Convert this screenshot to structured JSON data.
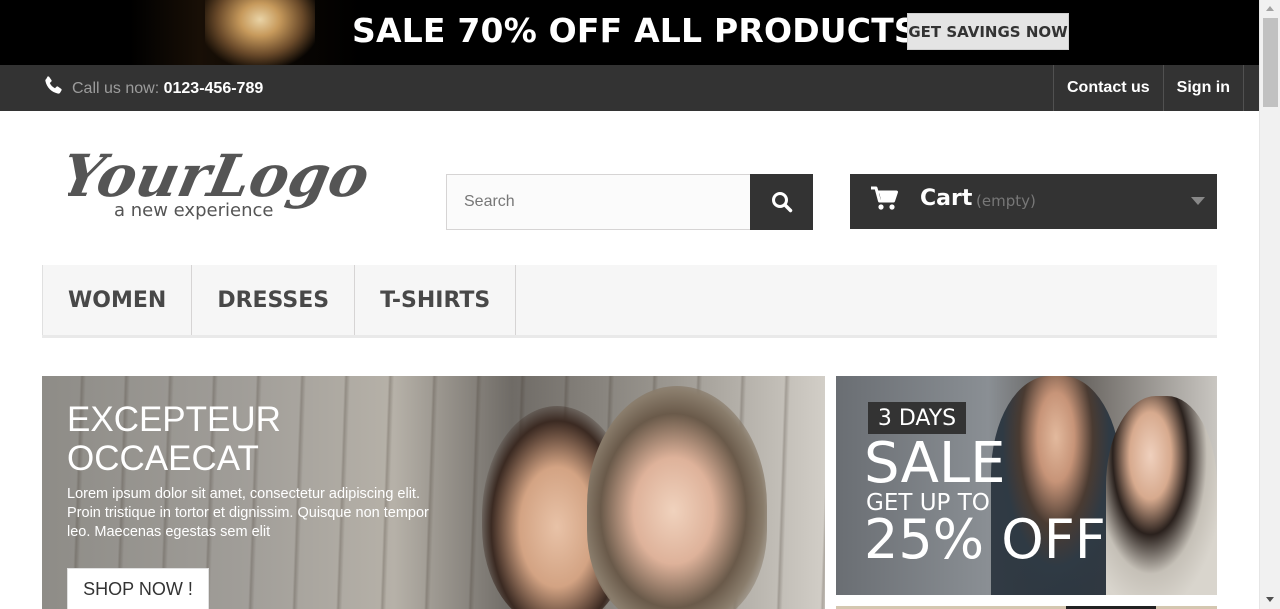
{
  "promo": {
    "headline": "SALE 70% OFF ALL PRODUCTS",
    "cta": "GET SAVINGS NOW"
  },
  "navbar": {
    "call_label": "Call us now:",
    "phone": "0123-456-789",
    "contact": "Contact us",
    "signin": "Sign in",
    "phone_icon": "phone-icon"
  },
  "header": {
    "logo_main": "YourLogo",
    "logo_tagline": "a new experience",
    "search_placeholder": "Search",
    "search_value": "",
    "cart_label": "Cart",
    "cart_status": "(empty)"
  },
  "menu": {
    "items": [
      {
        "label": "WOMEN"
      },
      {
        "label": "DRESSES"
      },
      {
        "label": "T-SHIRTS"
      }
    ]
  },
  "slider": {
    "title_line1": "EXCEPTEUR",
    "title_line2": "OCCAECAT",
    "description": "Lorem ipsum dolor sit amet, consectetur adipiscing elit. Proin tristique in tortor et dignissim. Quisque non tempor leo. Maecenas egestas sem elit",
    "button": "SHOP NOW !"
  },
  "side_banner": {
    "days": "3 DAYS",
    "sale": "SALE",
    "get_up_to": "GET UP TO",
    "percent": "25% OFF"
  },
  "colors": {
    "dark": "#333333",
    "black": "#000000",
    "menu_bg": "#f6f6f6",
    "text": "#484848"
  }
}
